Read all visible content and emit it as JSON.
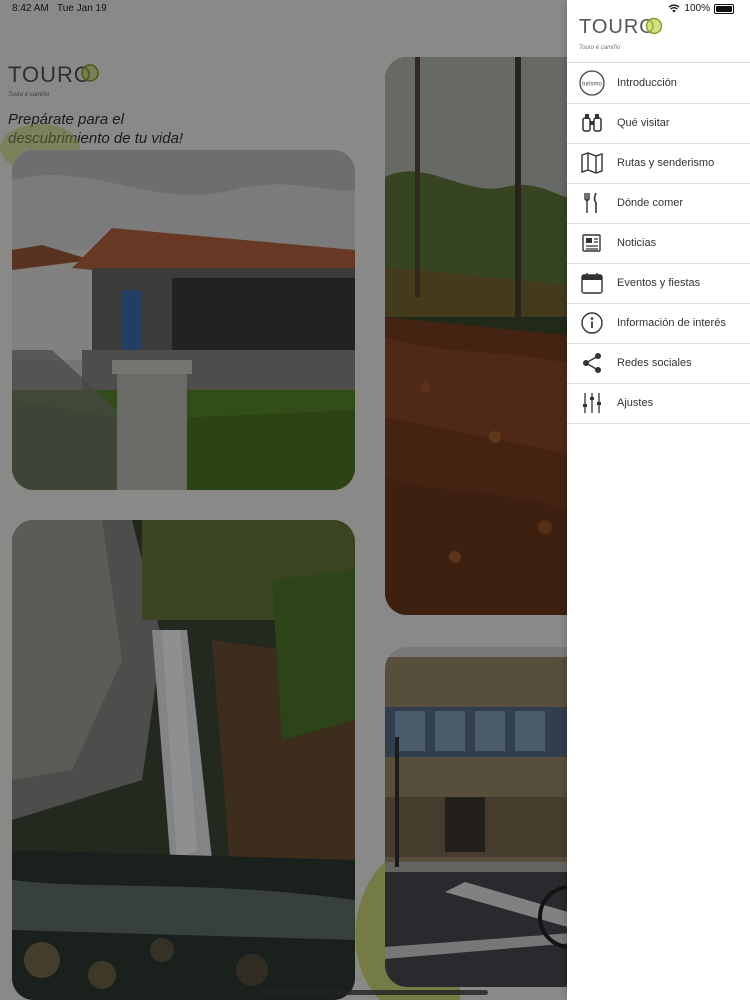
{
  "status_bar": {
    "time": "8:42 AM",
    "date": "Tue Jan 19",
    "battery": "100%"
  },
  "brand": {
    "logo_text": "TOURO",
    "logo_subtitle": "Touro é camiño",
    "drawer_logo_badge": "turismo"
  },
  "main": {
    "tagline_line1": "Prepárate para el",
    "tagline_line2": "descubrimiento de tu vida!",
    "cards": [
      {
        "subject": "stone granary building"
      },
      {
        "subject": "autumn forest path"
      },
      {
        "subject": "waterfall"
      },
      {
        "subject": "town hall with cyclist"
      }
    ]
  },
  "drawer": {
    "items": [
      {
        "icon": "turismo-badge-icon",
        "label": "Introducción"
      },
      {
        "icon": "binoculars-icon",
        "label": "Qué visitar"
      },
      {
        "icon": "map-icon",
        "label": "Rutas y senderismo"
      },
      {
        "icon": "fork-knife-icon",
        "label": "Dónde comer"
      },
      {
        "icon": "newspaper-icon",
        "label": "Noticias"
      },
      {
        "icon": "calendar-icon",
        "label": "Eventos y fiestas"
      },
      {
        "icon": "info-icon",
        "label": "Información de interés"
      },
      {
        "icon": "share-icon",
        "label": "Redes sociales"
      },
      {
        "icon": "sliders-icon",
        "label": "Ajustes"
      }
    ]
  },
  "colors": {
    "accent_green": "#b5c737",
    "overlay": "#000000"
  }
}
